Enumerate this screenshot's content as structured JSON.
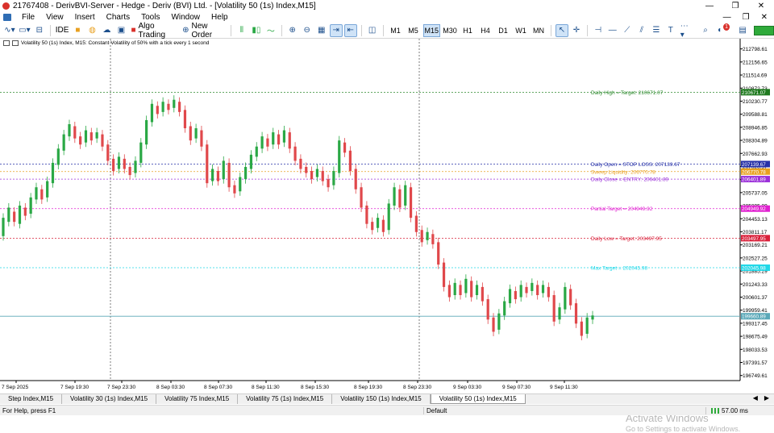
{
  "window": {
    "title": "21767408 - DerivBVI-Server - Hedge - Deriv (BVI) Ltd. - [Volatility 50 (1s) Index,M15]",
    "min_glyph": "—",
    "max_glyph": "❐",
    "close_glyph": "✕"
  },
  "menu": {
    "items": [
      "File",
      "View",
      "Insert",
      "Charts",
      "Tools",
      "Window",
      "Help"
    ],
    "right": [
      "—",
      "❐",
      "✕"
    ]
  },
  "toolbar": {
    "ide_label": "IDE",
    "algo_label": "Algo Trading",
    "new_order_label": "New Order",
    "timeframes": [
      "M1",
      "M5",
      "M15",
      "M30",
      "H1",
      "H4",
      "D1",
      "W1",
      "MN"
    ],
    "active_timeframe": "M15",
    "notification_count": "1"
  },
  "chart": {
    "header": "Volatility 50 (1s) Index, M15:  Constant Volatility of 50% with a tick every 1 second",
    "colors": {
      "bull": "#2aa845",
      "bear": "#e0484b",
      "grid": "#000000",
      "axis_bg": "#ffffff"
    }
  },
  "chart_data": {
    "type": "candlestick",
    "ylim": [
      196500,
      213300
    ],
    "price_ticks": [
      "212798.61",
      "212156.65",
      "211514.69",
      "210872.73",
      "210230.77",
      "209588.81",
      "208946.85",
      "208304.89",
      "207662.93",
      "207020.97",
      "206379.01",
      "205737.05",
      "205095.09",
      "204453.13",
      "203811.17",
      "203169.21",
      "202527.25",
      "201885.29",
      "201243.33",
      "200601.37",
      "199959.41",
      "199317.45",
      "198675.49",
      "198033.53",
      "197391.57",
      "196749.61"
    ],
    "time_labels": [
      "7 Sep 2025",
      "7 Sep 19:30",
      "7 Sep 23:30",
      "8 Sep 03:30",
      "8 Sep 07:30",
      "8 Sep 11:30",
      "8 Sep 15:30",
      "8 Sep 19:30",
      "8 Sep 23:30",
      "9 Sep 03:30",
      "9 Sep 07:30",
      "9 Sep 11:30"
    ],
    "levels": [
      {
        "name": "Daily High",
        "text": "Daily High = Target: 210671.07",
        "value": 210671.07,
        "tag": "210671.07",
        "color": "#2e8b2e",
        "tag_bg": "#1f7a1f"
      },
      {
        "name": "Daily Open",
        "text": "Daily Open = STOP LOSS: 207139.67",
        "value": 207139.67,
        "tag": "207139.67",
        "color": "#2631a8",
        "tag_bg": "#2631a8"
      },
      {
        "name": "Sweep Liquidity",
        "text": "Sweep Liquidity: 206770.78",
        "value": 206770.78,
        "tag": "206770.78",
        "color": "#e8a020",
        "tag_bg": "#e8a020"
      },
      {
        "name": "Daily Close",
        "text": "Daily Close = ENTRY: 206401.89",
        "value": 206401.89,
        "tag": "206401.89",
        "color": "#9b30d9",
        "tag_bg": "#9b30d9"
      },
      {
        "name": "Partial Target",
        "text": "Partial Target = 204949.92",
        "value": 204949.92,
        "tag": "204949.92",
        "color": "#e020d0",
        "tag_bg": "#e020d0"
      },
      {
        "name": "Daily Low",
        "text": "Daily Low = Target: 203497.95",
        "value": 203497.95,
        "tag": "203497.95",
        "color": "#d9203a",
        "tag_bg": "#d9203a"
      },
      {
        "name": "Max Target",
        "text": "Max Target = 202045.98",
        "value": 202045.98,
        "tag": "202045.98",
        "color": "#20d8e8",
        "tag_bg": "#20d8e8"
      }
    ],
    "current_price": {
      "tag": "199660.89",
      "value": 199660.89,
      "color": "#5aa8b8"
    },
    "series": [
      {
        "o": 203600,
        "c": 204500
      },
      {
        "o": 204300,
        "c": 205000
      },
      {
        "o": 204800,
        "c": 204300
      },
      {
        "o": 204200,
        "c": 205100
      },
      {
        "o": 205000,
        "c": 204600
      },
      {
        "o": 204700,
        "c": 205500
      },
      {
        "o": 205400,
        "c": 206000
      },
      {
        "o": 205900,
        "c": 205400
      },
      {
        "o": 205500,
        "c": 206300
      },
      {
        "o": 206200,
        "c": 207200
      },
      {
        "o": 207100,
        "c": 207900
      },
      {
        "o": 207800,
        "c": 208600
      },
      {
        "o": 208500,
        "c": 209100
      },
      {
        "o": 209000,
        "c": 208400
      },
      {
        "o": 208500,
        "c": 208100
      },
      {
        "o": 208200,
        "c": 208800
      },
      {
        "o": 208700,
        "c": 208300
      },
      {
        "o": 208400,
        "c": 208700
      },
      {
        "o": 208600,
        "c": 208000
      },
      {
        "o": 208100,
        "c": 207300
      },
      {
        "o": 207400,
        "c": 206800
      },
      {
        "o": 206900,
        "c": 207500
      },
      {
        "o": 207400,
        "c": 206900
      },
      {
        "o": 207000,
        "c": 206600
      },
      {
        "o": 206700,
        "c": 207300
      },
      {
        "o": 207200,
        "c": 208200
      },
      {
        "o": 208100,
        "c": 209300
      },
      {
        "o": 209200,
        "c": 210100
      },
      {
        "o": 210000,
        "c": 209600
      },
      {
        "o": 209700,
        "c": 210200
      },
      {
        "o": 210100,
        "c": 209800
      },
      {
        "o": 209900,
        "c": 210300
      },
      {
        "o": 210200,
        "c": 209700
      },
      {
        "o": 209800,
        "c": 208900
      },
      {
        "o": 209000,
        "c": 208300
      },
      {
        "o": 208400,
        "c": 208900
      },
      {
        "o": 208800,
        "c": 208000
      },
      {
        "o": 208100,
        "c": 206200
      },
      {
        "o": 206300,
        "c": 206900
      },
      {
        "o": 206800,
        "c": 206300
      },
      {
        "o": 206400,
        "c": 207300
      },
      {
        "o": 207200,
        "c": 206000
      },
      {
        "o": 206100,
        "c": 205700
      },
      {
        "o": 205800,
        "c": 206500
      },
      {
        "o": 206400,
        "c": 207000
      },
      {
        "o": 206900,
        "c": 207600
      },
      {
        "o": 207500,
        "c": 208000
      },
      {
        "o": 207900,
        "c": 208500
      },
      {
        "o": 208400,
        "c": 208000
      },
      {
        "o": 208100,
        "c": 208700
      },
      {
        "o": 208600,
        "c": 208100
      },
      {
        "o": 208200,
        "c": 208800
      },
      {
        "o": 208700,
        "c": 207900
      },
      {
        "o": 208000,
        "c": 207300
      },
      {
        "o": 207400,
        "c": 206900
      },
      {
        "o": 207000,
        "c": 206700
      },
      {
        "o": 206800,
        "c": 206400
      },
      {
        "o": 206500,
        "c": 206900
      },
      {
        "o": 206800,
        "c": 206300
      },
      {
        "o": 206400,
        "c": 206000
      },
      {
        "o": 206100,
        "c": 206800
      },
      {
        "o": 206700,
        "c": 208300
      },
      {
        "o": 208200,
        "c": 207700
      },
      {
        "o": 207800,
        "c": 206800
      },
      {
        "o": 206900,
        "c": 205900
      },
      {
        "o": 206000,
        "c": 205000
      },
      {
        "o": 205100,
        "c": 204200
      },
      {
        "o": 204300,
        "c": 203900
      },
      {
        "o": 204000,
        "c": 204500
      },
      {
        "o": 204400,
        "c": 203800
      },
      {
        "o": 203900,
        "c": 205200
      },
      {
        "o": 205100,
        "c": 206000
      },
      {
        "o": 205900,
        "c": 205000
      },
      {
        "o": 205100,
        "c": 206100
      },
      {
        "o": 206000,
        "c": 204500
      },
      {
        "o": 204600,
        "c": 203800
      },
      {
        "o": 203900,
        "c": 203300
      },
      {
        "o": 203400,
        "c": 203800
      },
      {
        "o": 203700,
        "c": 203200
      },
      {
        "o": 203300,
        "c": 202200
      },
      {
        "o": 202300,
        "c": 201100
      },
      {
        "o": 201200,
        "c": 200600
      },
      {
        "o": 200700,
        "c": 201300
      },
      {
        "o": 201200,
        "c": 200700
      },
      {
        "o": 200800,
        "c": 201500
      },
      {
        "o": 201400,
        "c": 200600
      },
      {
        "o": 200700,
        "c": 201200
      },
      {
        "o": 201100,
        "c": 200400
      },
      {
        "o": 200500,
        "c": 199500
      },
      {
        "o": 199600,
        "c": 198900
      },
      {
        "o": 199000,
        "c": 199800
      },
      {
        "o": 199700,
        "c": 200400
      },
      {
        "o": 200300,
        "c": 201000
      },
      {
        "o": 200900,
        "c": 200500
      },
      {
        "o": 200600,
        "c": 201200
      },
      {
        "o": 201100,
        "c": 200800
      },
      {
        "o": 200900,
        "c": 201300
      },
      {
        "o": 201200,
        "c": 200700
      },
      {
        "o": 200800,
        "c": 201200
      },
      {
        "o": 201100,
        "c": 200600
      },
      {
        "o": 200700,
        "c": 199400
      },
      {
        "o": 199500,
        "c": 200100
      },
      {
        "o": 200000,
        "c": 201100
      },
      {
        "o": 201000,
        "c": 200200
      },
      {
        "o": 200300,
        "c": 199300
      },
      {
        "o": 199400,
        "c": 198700
      },
      {
        "o": 198800,
        "c": 199600
      },
      {
        "o": 199500,
        "c": 199700
      }
    ]
  },
  "tabs": [
    "Step Index,M15",
    "Volatility 30 (1s) Index,M15",
    "Volatility 75 Index,M15",
    "Volatility 75 (1s) Index,M15",
    "Volatility 150 (1s) Index,M15",
    "Volatility 50 (1s) Index,M15"
  ],
  "active_tab": "Volatility 50 (1s) Index,M15",
  "status": {
    "help": "For Help, press F1",
    "profile": "Default",
    "connection": "57.00 ms"
  },
  "watermark": {
    "line1": "Activate Windows",
    "line2": "Go to Settings to activate Windows."
  }
}
